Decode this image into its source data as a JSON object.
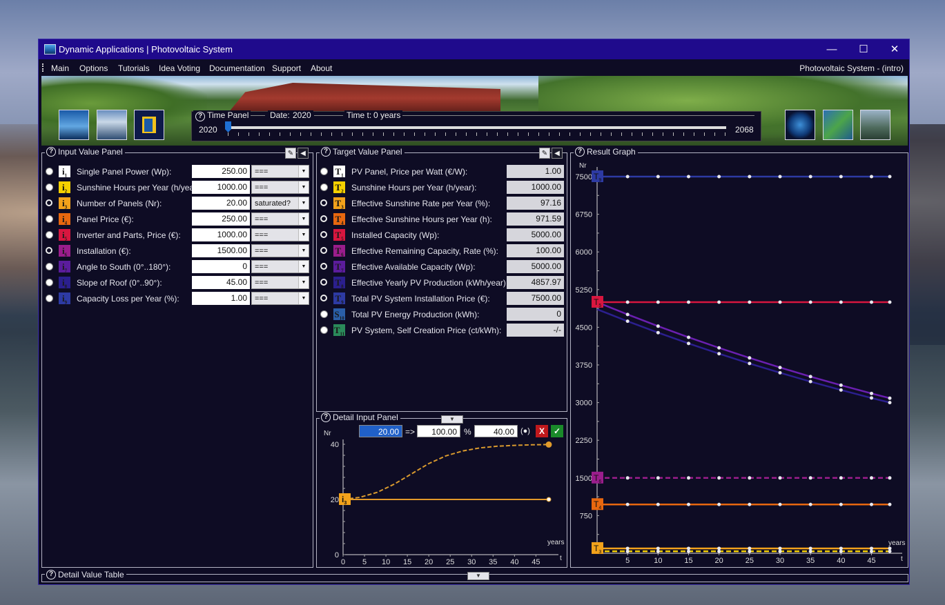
{
  "window": {
    "title": "Dynamic Applications | Photovoltaic System",
    "minimize": "—",
    "maximize": "☐",
    "close": "✕"
  },
  "menu": {
    "items": [
      "Main",
      "Options",
      "Tutorials",
      "Idea Voting",
      "Documentation",
      "Support",
      "About"
    ],
    "right_label": "Photovoltaic System - (intro)"
  },
  "time_panel": {
    "title": "Time Panel",
    "date_label": "Date:",
    "date_value": "2020",
    "time_label": "Time t:",
    "time_value": "0 years",
    "start_year": "2020",
    "end_year": "2068",
    "slider_fraction": 0
  },
  "input_panel": {
    "title": "Input Value Panel",
    "rows": [
      {
        "sym": "i",
        "sub": "1",
        "color": "#ffffff",
        "label": "Single Panel Power (Wp):",
        "value": "250.00",
        "select": "===",
        "radio": "filled"
      },
      {
        "sym": "i",
        "sub": "2",
        "color": "#f5d000",
        "label": "Sunshine Hours per Year (h/year):",
        "value": "1000.00",
        "select": "===",
        "radio": "filled"
      },
      {
        "sym": "i",
        "sub": "3",
        "color": "#f2a21b",
        "label": "Number of Panels (Nr):",
        "value": "20.00",
        "select": "saturated?",
        "radio": "hollow"
      },
      {
        "sym": "i",
        "sub": "4",
        "color": "#e8670f",
        "label": "Panel Price (€):",
        "value": "250.00",
        "select": "===",
        "radio": "filled"
      },
      {
        "sym": "i",
        "sub": "5",
        "color": "#d8163f",
        "label": "Inverter and Parts, Price (€):",
        "value": "1000.00",
        "select": "===",
        "radio": "filled"
      },
      {
        "sym": "i",
        "sub": "6",
        "color": "#9a1d8c",
        "label": "Installation (€):",
        "value": "1500.00",
        "select": "===",
        "radio": "hollow"
      },
      {
        "sym": "i",
        "sub": "7",
        "color": "#5b1c9c",
        "label": "Angle to South (0°..180°):",
        "value": "0",
        "select": "===",
        "radio": "filled"
      },
      {
        "sym": "i",
        "sub": "8",
        "color": "#2b1f8e",
        "label": "Slope of Roof (0°..90°):",
        "value": "45.00",
        "select": "===",
        "radio": "filled"
      },
      {
        "sym": "i",
        "sub": "9",
        "color": "#2d3aa3",
        "label": "Capacity Loss per Year (%):",
        "value": "1.00",
        "select": "===",
        "radio": "filled"
      }
    ]
  },
  "target_panel": {
    "title": "Target Value Panel",
    "rows": [
      {
        "sym": "T",
        "sub": "1",
        "color": "#ffffff",
        "label": "PV Panel, Price per Watt (€/W):",
        "value": "1.00",
        "radio": "filled"
      },
      {
        "sym": "T",
        "sub": "2",
        "color": "#f5d000",
        "label": "Sunshine Hours per Year (h/year):",
        "value": "1000.00",
        "radio": "filled"
      },
      {
        "sym": "T",
        "sub": "3",
        "color": "#f2a21b",
        "label": "Effective Sunshine Rate per Year (%):",
        "value": "97.16",
        "radio": "hollow"
      },
      {
        "sym": "T",
        "sub": "4",
        "color": "#e8670f",
        "label": "Effective Sunshine Hours per Year (h):",
        "value": "971.59",
        "radio": "hollow"
      },
      {
        "sym": "T",
        "sub": "5",
        "color": "#d8163f",
        "label": "Installed Capacity (Wp):",
        "value": "5000.00",
        "radio": "hollow"
      },
      {
        "sym": "T",
        "sub": "6",
        "color": "#9a1d8c",
        "label": "Effective Remaining Capacity, Rate (%):",
        "value": "100.00",
        "radio": "hollow"
      },
      {
        "sym": "T",
        "sub": "7",
        "color": "#5b1c9c",
        "label": "Effective Available Capacity (Wp):",
        "value": "5000.00",
        "radio": "hollow"
      },
      {
        "sym": "T",
        "sub": "8",
        "color": "#2b1f8e",
        "label": "Effective Yearly PV Production (kWh/year):",
        "value": "4857.97",
        "radio": "hollow"
      },
      {
        "sym": "T",
        "sub": "9",
        "color": "#2d3aa3",
        "label": "Total PV System Installation Price (€):",
        "value": "7500.00",
        "radio": "hollow"
      },
      {
        "sym": "S",
        "sub": "10",
        "color": "#2a5ea8",
        "label": "Total PV Energy Production (kWh):",
        "value": "0",
        "radio": "filled"
      },
      {
        "sym": "T",
        "sub": "11",
        "color": "#2a8a5a",
        "label": "PV System, Self Creation Price (ct/kWh):",
        "value": "-/-",
        "radio": "filled"
      }
    ]
  },
  "detail_input": {
    "title": "Detail Input Panel",
    "value": "20.00",
    "arrow": "=>",
    "percent": "100.00",
    "percent_unit": "%",
    "target": "40.00",
    "target_unit": "(●)",
    "cancel": "X",
    "confirm": "✓",
    "ylabel": "Nr",
    "xlabel": "years",
    "tlabel": "t",
    "var_label": "i3",
    "var_sym": "i",
    "var_sub": "3"
  },
  "result_graph": {
    "title": "Result Graph",
    "ylabel": "Nr",
    "xlabel": "years",
    "tlabel": "t"
  },
  "detail_table": {
    "title": "Detail Value Table"
  },
  "chart_data": [
    {
      "type": "line",
      "title": "",
      "ylabel": "Nr",
      "xlabel": "years",
      "xlim": [
        0,
        48
      ],
      "ylim": [
        0,
        40
      ],
      "x_ticks": [
        0,
        5,
        10,
        15,
        20,
        25,
        30,
        35,
        40,
        45
      ],
      "y_ticks": [
        0,
        20,
        40
      ],
      "series": [
        {
          "name": "i3",
          "x": [
            0,
            48
          ],
          "y": [
            20,
            20
          ],
          "style": "solid",
          "color": "#e39a2a"
        },
        {
          "name": "",
          "x": [
            0,
            4,
            8,
            12,
            16,
            20,
            24,
            28,
            32,
            36,
            40,
            44,
            48
          ],
          "y": [
            20,
            20.8,
            22.6,
            25.6,
            29.3,
            33.0,
            35.8,
            37.6,
            38.7,
            39.3,
            39.6,
            39.8,
            39.9
          ],
          "style": "dashed",
          "color": "#d99a2e"
        }
      ]
    },
    {
      "type": "line",
      "title": "",
      "ylabel": "Nr",
      "xlabel": "years",
      "xlim": [
        0,
        48
      ],
      "ylim": [
        0,
        7500
      ],
      "x_ticks": [
        5,
        10,
        15,
        20,
        25,
        30,
        35,
        40,
        45
      ],
      "y_ticks": [
        750,
        1500,
        2250,
        3000,
        3750,
        4500,
        5250,
        6000,
        6750,
        7500
      ],
      "markers_x": [
        0,
        5,
        10,
        15,
        20,
        25,
        30,
        35,
        40,
        45,
        48
      ],
      "series": [
        {
          "name": "T9",
          "sym": "T",
          "sub": "9",
          "y": [
            7500,
            7500,
            7500,
            7500,
            7500,
            7500,
            7500,
            7500,
            7500,
            7500,
            7500
          ],
          "color": "#2d3aa3",
          "style": "solid"
        },
        {
          "name": "T5",
          "sym": "T",
          "sub": "5",
          "y": [
            5000,
            5000,
            5000,
            5000,
            5000,
            5000,
            5000,
            5000,
            5000,
            5000,
            5000
          ],
          "color": "#d8163f",
          "style": "solid"
        },
        {
          "name": "T7",
          "sym": "T",
          "sub": "7",
          "y": [
            5000,
            4755,
            4522,
            4300,
            4090,
            3890,
            3699,
            3518,
            3346,
            3182,
            3088
          ],
          "color": "#6a1fb0",
          "style": "solid"
        },
        {
          "name": "T8",
          "sym": "T",
          "sub": "8",
          "y": [
            4858,
            4620,
            4393,
            4178,
            3974,
            3779,
            3594,
            3418,
            3251,
            3092,
            3000
          ],
          "color": "#2b1f8e",
          "style": "solid"
        },
        {
          "name": "T6",
          "sym": "T",
          "sub": "6",
          "y": [
            1500,
            1500,
            1500,
            1500,
            1500,
            1500,
            1500,
            1500,
            1500,
            1500,
            1500
          ],
          "color": "#9a1d8c",
          "style": "dashed"
        },
        {
          "name": "T4",
          "sym": "T",
          "sub": "4",
          "y": [
            972,
            972,
            972,
            972,
            972,
            972,
            972,
            972,
            972,
            972,
            972
          ],
          "color": "#e8670f",
          "style": "solid"
        },
        {
          "name": "T3",
          "sym": "T",
          "sub": "3",
          "y": [
            97,
            97,
            97,
            97,
            97,
            97,
            97,
            97,
            97,
            97,
            97
          ],
          "color": "#f2a21b",
          "style": "solid"
        },
        {
          "name": "T2",
          "sym": "T",
          "sub": "2",
          "y": [
            40,
            40,
            40,
            40,
            40,
            40,
            40,
            40,
            40,
            40,
            40
          ],
          "color": "#f5d000",
          "style": "dashed"
        }
      ]
    }
  ]
}
